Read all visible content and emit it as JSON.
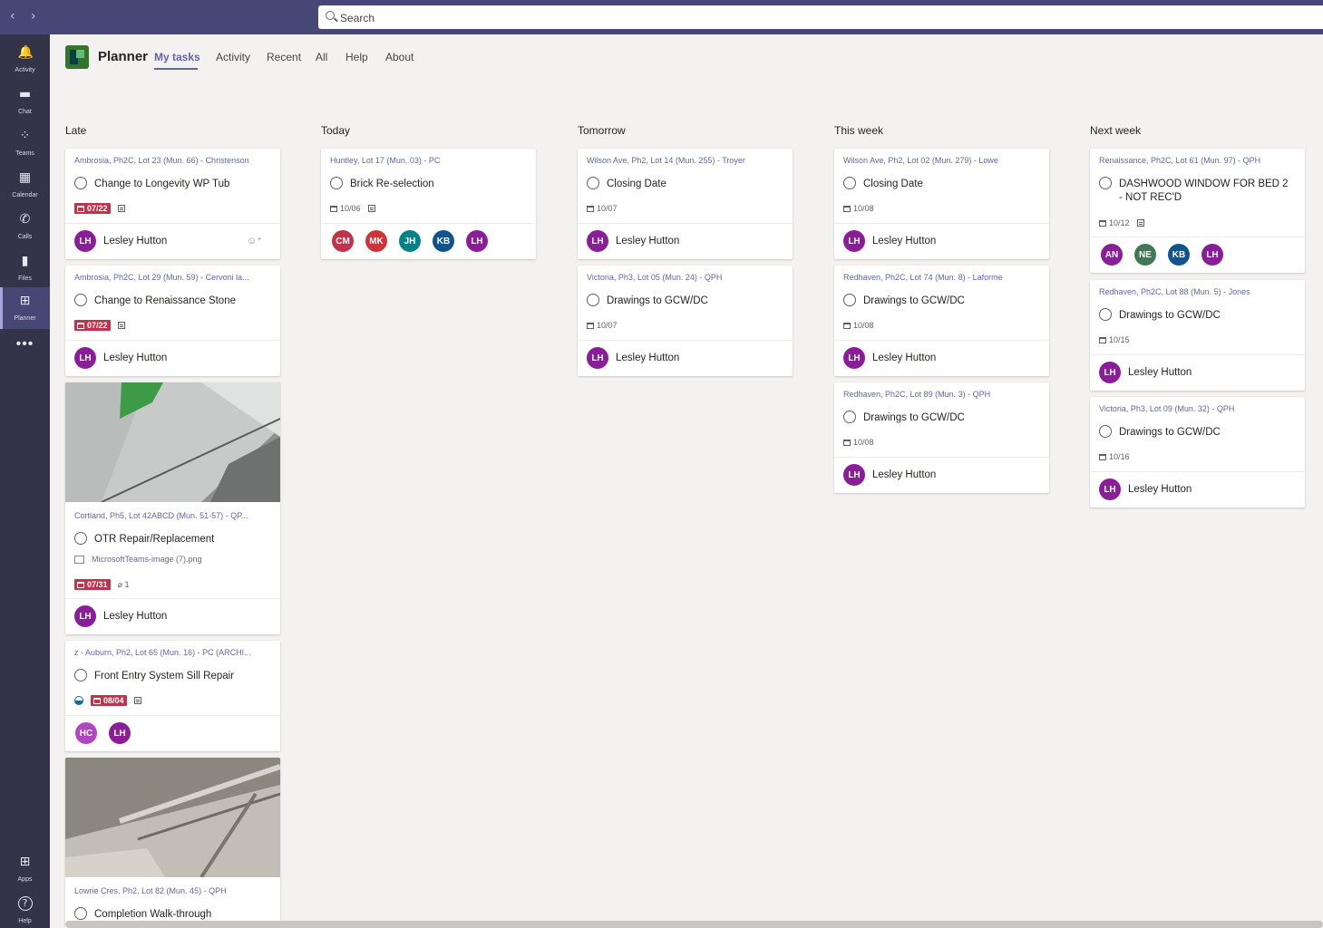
{
  "search": {
    "placeholder": "Search"
  },
  "rail": [
    {
      "label": "Activity",
      "icon": "bell-icon",
      "glyph": "🔔"
    },
    {
      "label": "Chat",
      "icon": "chat-icon",
      "glyph": "▬"
    },
    {
      "label": "Teams",
      "icon": "teams-icon",
      "glyph": "⁘"
    },
    {
      "label": "Calendar",
      "icon": "calendar-icon",
      "glyph": "▦"
    },
    {
      "label": "Calls",
      "icon": "phone-icon",
      "glyph": "✆"
    },
    {
      "label": "Files",
      "icon": "file-icon",
      "glyph": "▮"
    },
    {
      "label": "Planner",
      "icon": "planner-icon",
      "glyph": "⊞"
    }
  ],
  "rail_more": "•••",
  "rail_bottom": [
    {
      "label": "Apps",
      "icon": "apps-icon",
      "glyph": "⊞"
    },
    {
      "label": "Help",
      "icon": "help-icon",
      "glyph": "?"
    }
  ],
  "app": {
    "title": "Planner",
    "tabs": [
      "My tasks",
      "Activity",
      "Recent",
      "All",
      "Help",
      "About"
    ]
  },
  "columns": {
    "late": "Late",
    "today": "Today",
    "tomorrow": "Tomorrow",
    "this_week": "This week",
    "next_week": "Next week"
  },
  "tasks": {
    "late1": {
      "crumb": "Ambrosia, Ph2C, Lot 23 (Mun. 66) - Christenson",
      "title": "Change to Longevity WP Tub",
      "due": "07/22",
      "assignee": "Lesley Hutton",
      "initials": "LH"
    },
    "late2": {
      "crumb": "Ambrosia, Ph2C, Lot 29 (Mun. 59) - Cervoni la...",
      "title": "Change to Renaissance Stone",
      "due": "07/22",
      "assignee": "Lesley Hutton",
      "initials": "LH"
    },
    "late3": {
      "crumb": "Cortland, Ph5, Lot 42ABCD (Mun. 51-57) - QP...",
      "title": "OTR Repair/Replacement",
      "attachment": "MicrosoftTeams-image (7).png",
      "due": "07/31",
      "attach_count": "1",
      "assignee": "Lesley Hutton",
      "initials": "LH"
    },
    "late4": {
      "crumb": "z - Auburn, Ph2, Lot 65 (Mun. 16) - PC (ARCHI...",
      "title": "Front Entry System Sill Repair",
      "due": "08/04",
      "avatars": [
        "HC",
        "LH"
      ]
    },
    "late5": {
      "crumb": "Lowrie Cres, Ph2, Lot 82 (Mun. 45) - QPH",
      "title": "Completion Walk-through"
    },
    "today1": {
      "crumb": "Huntley, Lot 17 (Mun. 03) - PC",
      "title": "Brick Re-selection",
      "due": "10/06",
      "avatars": [
        "CM",
        "MK",
        "JH",
        "KB",
        "LH"
      ]
    },
    "tom1": {
      "crumb": "Wilson Ave, Ph2, Lot 14 (Mun. 255) - Troyer",
      "title": "Closing Date",
      "due": "10/07",
      "assignee": "Lesley Hutton",
      "initials": "LH"
    },
    "tom2": {
      "crumb": "Victoria, Ph3, Lot 05 (Mun. 24) - QPH",
      "title": "Drawings to GCW/DC",
      "due": "10/07",
      "assignee": "Lesley Hutton",
      "initials": "LH"
    },
    "wk1": {
      "crumb": "Wilson Ave, Ph2, Lot 02 (Mun. 279) - Lowe",
      "title": "Closing Date",
      "due": "10/08",
      "assignee": "Lesley Hutton",
      "initials": "LH"
    },
    "wk2": {
      "crumb": "Redhaven, Ph2C, Lot 74 (Mun. 8) - Laforme",
      "title": "Drawings to GCW/DC",
      "due": "10/08",
      "assignee": "Lesley Hutton",
      "initials": "LH"
    },
    "wk3": {
      "crumb": "Redhaven, Ph2C, Lot 89 (Mun. 3) - QPH",
      "title": "Drawings to GCW/DC",
      "due": "10/08",
      "assignee": "Lesley Hutton",
      "initials": "LH"
    },
    "nw1": {
      "crumb": "Renaissance, Ph2C, Lot 61 (Mun. 97) - QPH",
      "title": "DASHWOOD WINDOW FOR BED 2 - NOT REC'D",
      "due": "10/12",
      "avatars": [
        "AN",
        "NE",
        "KB",
        "LH"
      ]
    },
    "nw2": {
      "crumb": "Redhaven, Ph2C, Lot 88 (Mun. 5) - Jones",
      "title": "Drawings to GCW/DC",
      "due": "10/15",
      "assignee": "Lesley Hutton",
      "initials": "LH"
    },
    "nw3": {
      "crumb": "Victoria, Ph3, Lot 09 (Mun. 32) - QPH",
      "title": "Drawings to GCW/DC",
      "due": "10/16",
      "assignee": "Lesley Hutton",
      "initials": "LH"
    }
  },
  "colors": {
    "accent": "#6264a7",
    "late_badge": "#c4314b",
    "titlebar": "#464775",
    "rail": "#33344a",
    "avatar_LH": "#8a1e98",
    "avatar_CM": "#c4314b",
    "avatar_MK": "#d13438",
    "avatar_JH": "#038387",
    "avatar_KB": "#0f548c",
    "avatar_HC": "#b146c2",
    "avatar_AN": "#8a1e98",
    "avatar_NE": "#407855"
  }
}
